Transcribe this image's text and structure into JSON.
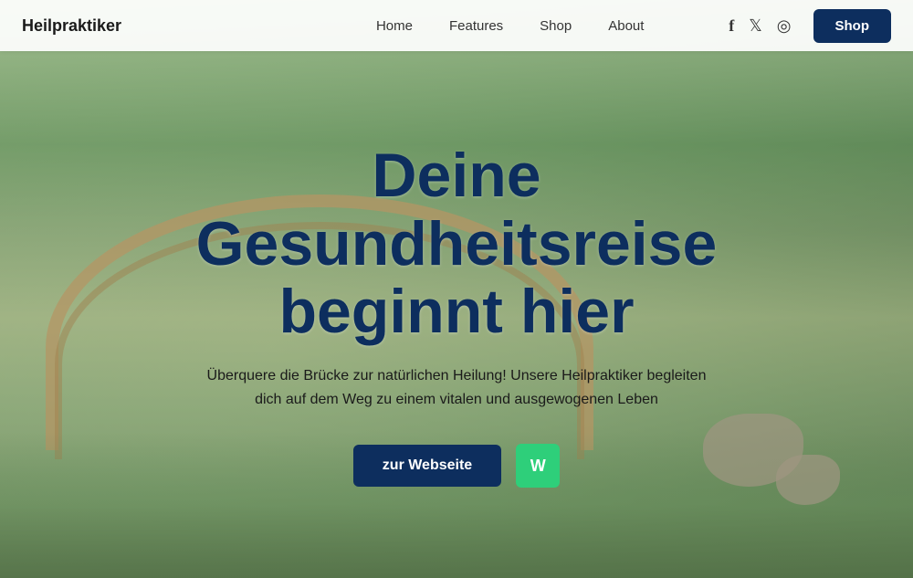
{
  "brand": {
    "name": "Heilpraktiker"
  },
  "nav": {
    "links": [
      {
        "label": "Home",
        "id": "home"
      },
      {
        "label": "Features",
        "id": "features"
      },
      {
        "label": "Shop",
        "id": "shop"
      },
      {
        "label": "About",
        "id": "about"
      }
    ],
    "shop_button": "Shop"
  },
  "social": {
    "facebook_label": "Facebook",
    "twitter_label": "Twitter",
    "instagram_label": "Instagram"
  },
  "hero": {
    "title_line1": "Deine",
    "title_line2": "Gesundheitsreise",
    "title_line3": "beginnt hier",
    "subtitle": "Überquere die Brücke zur natürlichen Heilung! Unsere Heilpraktiker begleiten dich auf dem Weg zu einem vitalen und ausgewogenen Leben",
    "cta_primary": "zur Webseite",
    "cta_secondary": "W"
  }
}
